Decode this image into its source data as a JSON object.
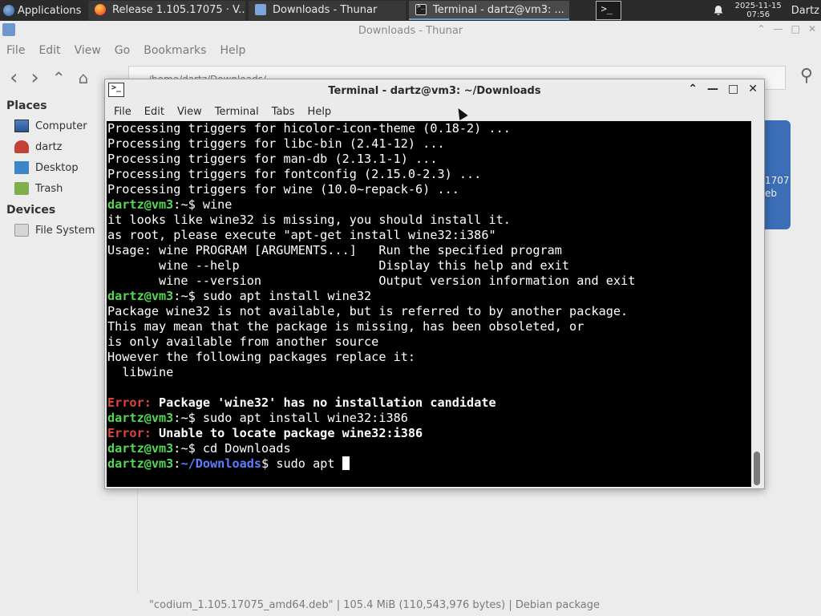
{
  "panel": {
    "applications": "Applications",
    "tasks": [
      {
        "label": "Release 1.105.17075 · V...",
        "icon": "firefox-icon"
      },
      {
        "label": "Downloads - Thunar",
        "icon": "folder-icon"
      },
      {
        "label": "Terminal - dartz@vm3: ...",
        "icon": "terminal-icon"
      }
    ],
    "date": "2025-11-15",
    "time": "07:56",
    "user": "Dartz"
  },
  "thunar": {
    "title": "Downloads - Thunar",
    "menu": [
      "File",
      "Edit",
      "View",
      "Go",
      "Bookmarks",
      "Help"
    ],
    "path": "/home/dartz/Downloads/",
    "sidebar": {
      "places_header": "Places",
      "places": [
        "Computer",
        "dartz",
        "Desktop",
        "Trash"
      ],
      "devices_header": "Devices",
      "devices": [
        "File System"
      ]
    },
    "file_tile_text": [
      "1707",
      "eb"
    ],
    "status": "\"codium_1.105.17075_amd64.deb\" | 105.4 MiB (110,543,976 bytes) | Debian package"
  },
  "terminal": {
    "title": "Terminal - dartz@vm3: ~/Downloads",
    "menu": [
      "File",
      "Edit",
      "View",
      "Terminal",
      "Tabs",
      "Help"
    ],
    "prompt_user": "dartz@vm3",
    "prompt_home": ":~$",
    "prompt_downloads_path": "~/Downloads",
    "lines": {
      "l1": "Processing triggers for hicolor-icon-theme (0.18-2) ...",
      "l2": "Processing triggers for libc-bin (2.41-12) ...",
      "l3": "Processing triggers for man-db (2.13.1-1) ...",
      "l4": "Processing triggers for fontconfig (2.15.0-2.3) ...",
      "l5": "Processing triggers for wine (10.0~repack-6) ...",
      "cmd1": " wine",
      "l7": "it looks like wine32 is missing, you should install it.",
      "l8": "as root, please execute \"apt-get install wine32:i386\"",
      "l9": "Usage: wine PROGRAM [ARGUMENTS...]   Run the specified program",
      "l10": "       wine --help                   Display this help and exit",
      "l11": "       wine --version                Output version information and exit",
      "cmd2": " sudo apt install wine32",
      "l13": "Package wine32 is not available, but is referred to by another package.",
      "l14": "This may mean that the package is missing, has been obsoleted, or",
      "l15": "is only available from another source",
      "l16": "However the following packages replace it:",
      "l17": "  libwine",
      "err_label": "Error:",
      "err1": " Package 'wine32' has no installation candidate",
      "cmd3": " sudo apt install wine32:i386",
      "err2": " Unable to locate package wine32:i386",
      "cmd4": " cd Downloads",
      "cmd5_prompt_suffix": "$",
      "cmd5": " sudo apt "
    }
  }
}
